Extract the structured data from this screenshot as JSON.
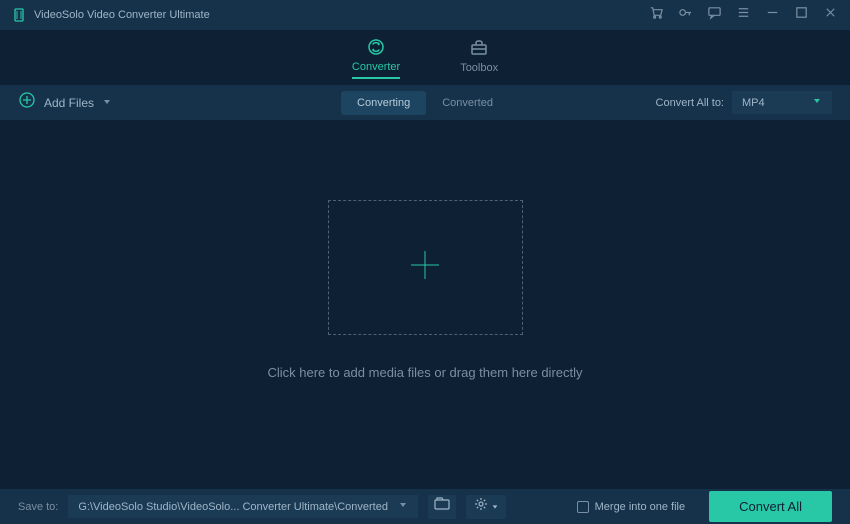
{
  "app": {
    "title": "VideoSolo Video Converter Ultimate"
  },
  "nav": {
    "converter": "Converter",
    "toolbox": "Toolbox"
  },
  "subbar": {
    "add_files": "Add Files",
    "converting": "Converting",
    "converted": "Converted",
    "convert_all_to": "Convert All to:",
    "format": "MP4"
  },
  "main": {
    "hint": "Click here to add media files or drag them here directly"
  },
  "bottom": {
    "save_to": "Save to:",
    "path": "G:\\VideoSolo Studio\\VideoSolo... Converter Ultimate\\Converted",
    "merge": "Merge into one file",
    "convert_all": "Convert All"
  }
}
